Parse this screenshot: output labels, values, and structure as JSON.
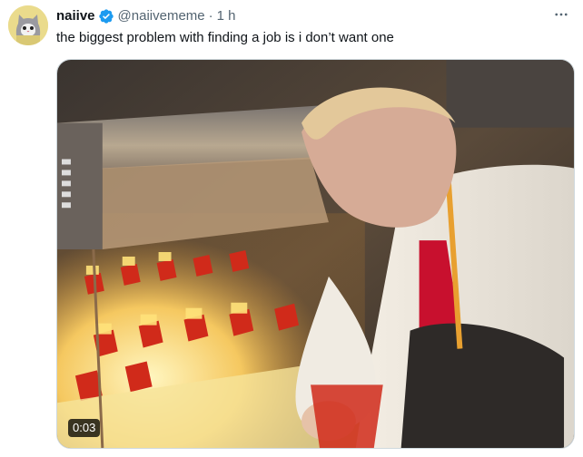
{
  "tweet": {
    "display_name": "naiive",
    "handle": "@naiivememe",
    "separator": "·",
    "time": "1 h",
    "text": "the biggest problem with finding a job is i don’t want one",
    "verified_icon": "verified-badge-icon",
    "more_icon": "more-horizontal-icon",
    "video": {
      "duration": "0:03"
    }
  },
  "colors": {
    "verified_blue": "#1d9bf0",
    "muted_text": "#536471",
    "primary_text": "#0f1419"
  }
}
